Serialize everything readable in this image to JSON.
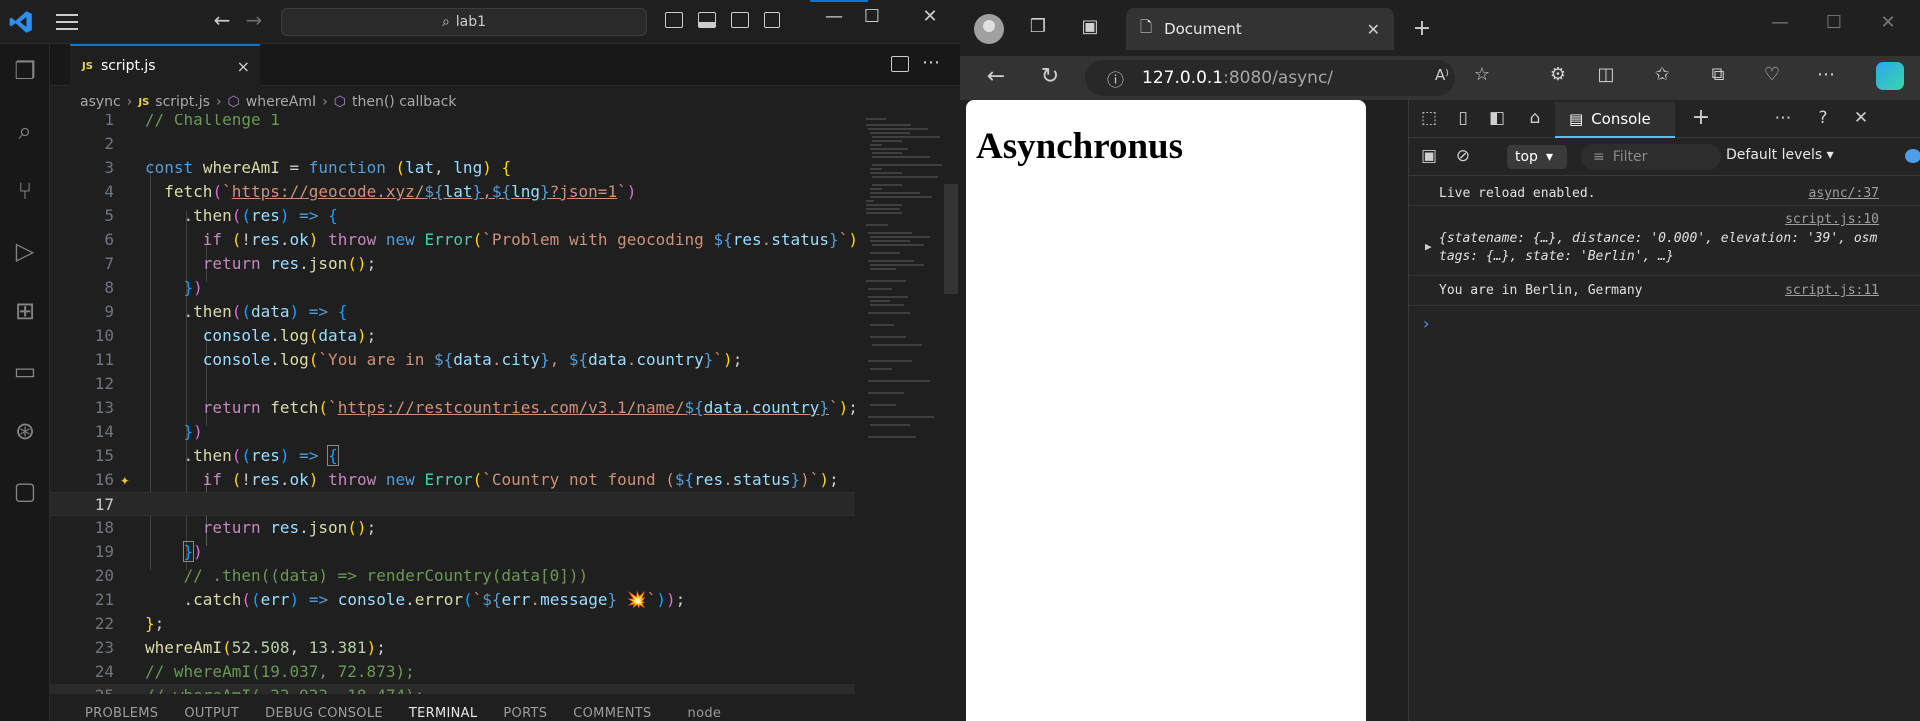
{
  "vscode": {
    "search_text": "lab1",
    "tab": {
      "badge": "JS",
      "filename": "script.js",
      "close": "×"
    },
    "breadcrumb": {
      "folder": "async",
      "file": "script.js",
      "symbol1": "whereAmI",
      "symbol2": "then() callback"
    },
    "line_numbers": [
      "1",
      "2",
      "3",
      "4",
      "5",
      "6",
      "7",
      "8",
      "9",
      "10",
      "11",
      "12",
      "13",
      "14",
      "15",
      "16",
      "17",
      "18",
      "19",
      "20",
      "21",
      "22",
      "23",
      "24",
      "25"
    ],
    "panel_tabs": [
      "PROBLEMS",
      "OUTPUT",
      "DEBUG CONSOLE",
      "TERMINAL",
      "PORTS",
      "COMMENTS"
    ],
    "active_panel_tab": "TERMINAL",
    "terminal_shell": "node"
  },
  "edge": {
    "tab_title": "Document",
    "url_host": "127.0.0.1",
    "url_path": ":8080/async/",
    "page_heading": "Asynchronus"
  },
  "devtools": {
    "active_tab": "Console",
    "context": "top",
    "filter_placeholder": "Filter",
    "levels": "Default levels",
    "messages": [
      {
        "text": "Live reload enabled.",
        "source": "async/:37"
      },
      {
        "text": "{statename: {…}, distance: '0.000', elevation: '39', osmtags: {…}, state: 'Berlin', …}",
        "source": "script.js:10"
      },
      {
        "text": "You are in Berlin, Germany",
        "source": "script.js:11"
      }
    ]
  },
  "colors": {
    "vscode_accent": "#0078d4",
    "devtools_accent": "#4cc2ff",
    "keyword": "#569cd6",
    "string": "#ce9178",
    "comment": "#6a9955"
  }
}
